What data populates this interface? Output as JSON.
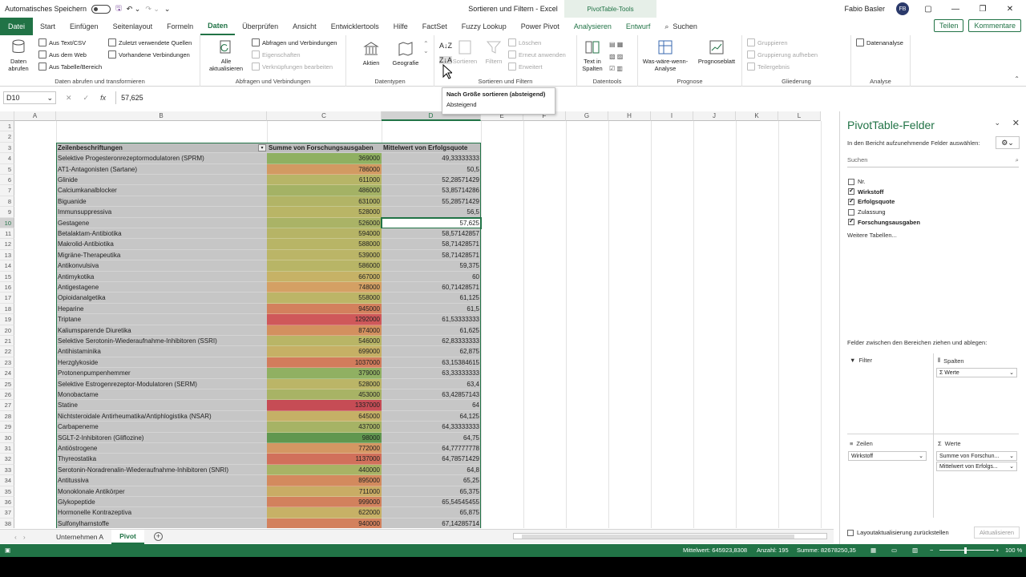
{
  "titlebar": {
    "autosave": "Automatisches Speichern",
    "doc_title": "Sortieren und Filtern  -  Excel",
    "context_title": "PivotTable-Tools",
    "user": "Fabio Basler",
    "initials": "FB"
  },
  "tabs": [
    "Datei",
    "Start",
    "Einfügen",
    "Seitenlayout",
    "Formeln",
    "Daten",
    "Überprüfen",
    "Ansicht",
    "Entwicklertools",
    "Hilfe",
    "FactSet",
    "Fuzzy Lookup",
    "Power Pivot",
    "Analysieren",
    "Entwurf",
    "Suchen"
  ],
  "share": "Teilen",
  "comments": "Kommentare",
  "ribbon": {
    "g1": {
      "label": "Daten abrufen und transformieren",
      "big": "Daten abrufen",
      "s1": "Aus Text/CSV",
      "s2": "Aus dem Web",
      "s3": "Aus Tabelle/Bereich",
      "s4": "Zuletzt verwendete Quellen",
      "s5": "Vorhandene Verbindungen"
    },
    "g2": {
      "label": "Abfragen und Verbindungen",
      "big": "Alle aktualisieren",
      "s1": "Abfragen und Verbindungen",
      "s2": "Eigenschaften",
      "s3": "Verknüpfungen bearbeiten"
    },
    "g3": {
      "label": "Datentypen",
      "b1": "Aktien",
      "b2": "Geografie"
    },
    "g4": {
      "label": "Sortieren und Filtern",
      "b1": "Sortieren",
      "b2": "Filtern",
      "s1": "Löschen",
      "s2": "Erneut anwenden",
      "s3": "Erweitert"
    },
    "g5": {
      "label": "Datentools",
      "b1": "Text in Spalten"
    },
    "g6": {
      "label": "Prognose",
      "b1": "Was-wäre-wenn-Analyse",
      "b2": "Prognoseblatt"
    },
    "g7": {
      "label": "Gliederung",
      "s1": "Gruppieren",
      "s2": "Gruppierung aufheben",
      "s3": "Teilergebnis"
    },
    "g8": {
      "label": "Analyse",
      "s1": "Datenanalyse"
    }
  },
  "formula": {
    "namebox": "D10",
    "value": "57,625"
  },
  "tooltip": {
    "title": "Nach Größe sortieren (absteigend)",
    "desc": "Absteigend"
  },
  "columns": [
    "A",
    "B",
    "C",
    "D",
    "E",
    "F",
    "G",
    "H",
    "I",
    "J",
    "K",
    "L"
  ],
  "pivot": {
    "headers": [
      "Zeilenbeschriftungen",
      "Summe von Forschungsausgaben",
      "Mittelwert von Erfolgsquote"
    ],
    "rows": [
      [
        "Selektive Progesteronrezeptormodulatoren (SPRM)",
        "369000",
        "49,33333333"
      ],
      [
        "AT1-Antagonisten (Sartane)",
        "786000",
        "50,5"
      ],
      [
        "Glinide",
        "611000",
        "52,28571429"
      ],
      [
        "Calciumkanalblocker",
        "486000",
        "53,85714286"
      ],
      [
        "Biguanide",
        "631000",
        "55,28571429"
      ],
      [
        "Immunsuppressiva",
        "528000",
        "56,5"
      ],
      [
        "Gestagene",
        "526000",
        "57,625"
      ],
      [
        "Betalaktam-Antibiotika",
        "594000",
        "58,57142857"
      ],
      [
        "Makrolid-Antibiotika",
        "588000",
        "58,71428571"
      ],
      [
        "Migräne-Therapeutika",
        "539000",
        "58,71428571"
      ],
      [
        "Antikonvulsiva",
        "586000",
        "59,375"
      ],
      [
        "Antimykotika",
        "667000",
        "60"
      ],
      [
        "Antigestagene",
        "748000",
        "60,71428571"
      ],
      [
        "Opioidanalgetika",
        "558000",
        "61,125"
      ],
      [
        "Heparine",
        "945000",
        "61,5"
      ],
      [
        "Triptane",
        "1292000",
        "61,53333333"
      ],
      [
        "Kaliumsparende Diuretika",
        "874000",
        "61,625"
      ],
      [
        "Selektive Serotonin-Wiederaufnahme-Inhibitoren (SSRI)",
        "546000",
        "62,83333333"
      ],
      [
        "Antihistaminika",
        "699000",
        "62,875"
      ],
      [
        "Herzglykoside",
        "1037000",
        "63,15384615"
      ],
      [
        "Protonenpumpenhemmer",
        "379000",
        "63,33333333"
      ],
      [
        "Selektive Estrogenrezeptor-Modulatoren (SERM)",
        "528000",
        "63,4"
      ],
      [
        "Monobactame",
        "453000",
        "63,42857143"
      ],
      [
        "Statine",
        "1337000",
        "64"
      ],
      [
        "Nichtsteroidale Antirheumatika/Antiphlogistika (NSAR)",
        "645000",
        "64,125"
      ],
      [
        "Carbapeneme",
        "437000",
        "64,33333333"
      ],
      [
        "SGLT-2-Inhibitoren (Gliflozine)",
        "98000",
        "64,75"
      ],
      [
        "Antiöstrogene",
        "772000",
        "64,77777778"
      ],
      [
        "Thyreostatika",
        "1137000",
        "64,78571429"
      ],
      [
        "Serotonin-Noradrenalin-Wiederaufnahme-Inhibitoren (SNRI)",
        "440000",
        "64,8"
      ],
      [
        "Antitussiva",
        "895000",
        "65,25"
      ],
      [
        "Monoklonale Antikörper",
        "711000",
        "65,375"
      ],
      [
        "Glykopeptide",
        "999000",
        "65,54545455"
      ],
      [
        "Hormonelle Kontrazeptiva",
        "622000",
        "65,875"
      ],
      [
        "Sulfonylharnstoffe",
        "940000",
        "67,14285714"
      ]
    ],
    "row_colors": [
      "#8fb061",
      "#d29a62",
      "#b7b567",
      "#a4b265",
      "#b2b466",
      "#b9b566",
      "#aab366",
      "#b6b466",
      "#b8b566",
      "#bbb567",
      "#b8b566",
      "#c6b266",
      "#d4a064",
      "#bcb567",
      "#d3805d",
      "#cf585a",
      "#d3905f",
      "#b9b566",
      "#c6b065",
      "#d27c5c",
      "#90b062",
      "#bbb567",
      "#a8b365",
      "#c64c55",
      "#c5b066",
      "#a6b365",
      "#60974f",
      "#d49763",
      "#d1705b",
      "#a8b365",
      "#d38a5e",
      "#c9ac65",
      "#d2815d",
      "#c7b166",
      "#d3815d"
    ]
  },
  "pane": {
    "title": "PivotTable-Felder",
    "subtitle": "In den Bericht aufzunehmende Felder auswählen:",
    "search": "Suchen",
    "fields": [
      {
        "name": "Nr.",
        "checked": false
      },
      {
        "name": "Wirkstoff",
        "checked": true
      },
      {
        "name": "Erfolgsquote",
        "checked": true
      },
      {
        "name": "Zulassung",
        "checked": false
      },
      {
        "name": "Forschungsausgaben",
        "checked": true
      }
    ],
    "more": "Weitere Tabellen...",
    "drag": "Felder zwischen den Bereichen ziehen und ablegen:",
    "filter": "Filter",
    "columns": "Spalten",
    "columns_item": "Σ Werte",
    "rows": "Zeilen",
    "rows_item": "Wirkstoff",
    "values": "Werte",
    "values_items": [
      "Summe von Forschun...",
      "Mittelwert von Erfolgs..."
    ],
    "defer": "Layoutaktualisierung zurückstellen",
    "update": "Aktualisieren"
  },
  "sheets": [
    "Unternehmen A",
    "Pivot"
  ],
  "status": {
    "avg": "Mittelwert: 645923,8308",
    "count": "Anzahl: 195",
    "sum": "Summe: 82678250,35",
    "zoom": "100 %"
  }
}
